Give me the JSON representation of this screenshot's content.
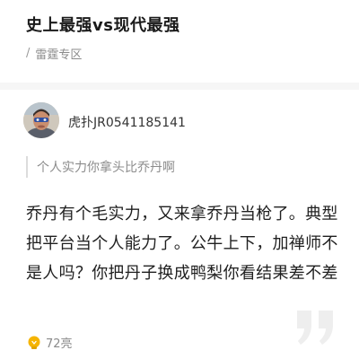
{
  "post": {
    "title": "史上最强vs现代最强",
    "section": "雷霆专区"
  },
  "comment": {
    "username": "虎扑JR0541185141",
    "quoted_text": "个人实力你拿头比乔丹啊",
    "body": "乔丹有个毛实力，又来拿乔丹当枪了。典型把平台当个人能力了。公牛上下，加禅师不是人吗？你把丹子换成鸭梨你看结果差不差",
    "likes": "72亮"
  },
  "icons": {
    "like": "lightbulb-icon",
    "decoration": "quote-mark-icon"
  },
  "colors": {
    "like_icon": "#f5b400",
    "quote_mark": "#eeeeee",
    "muted_text": "#8a8a8a"
  }
}
